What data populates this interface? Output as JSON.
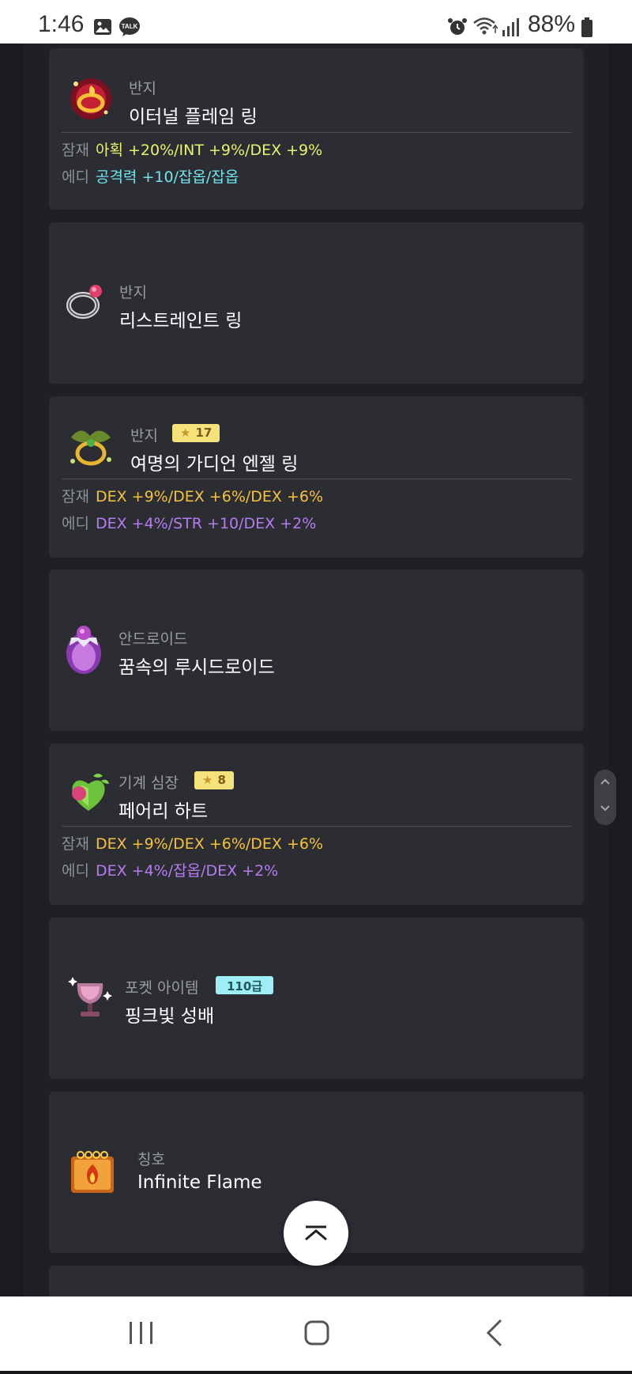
{
  "status_bar": {
    "time": "1:46",
    "notification_icons": [
      "gallery-icon",
      "kakaotalk-icon"
    ],
    "kakaotalk_label": "TALK",
    "system_icons": [
      "alarm-icon",
      "wifi-icon",
      "signal-icon"
    ],
    "battery_percent": "88%"
  },
  "items": [
    {
      "category": "반지",
      "name": "이터널 플레임 링",
      "icon": "flame-ring-icon",
      "potential_label": "잠재",
      "potential": "아획 +20%/INT +9%/DEX +9%",
      "additional_label": "에디",
      "additional": "공격력 +10/잡옵/잡옵"
    },
    {
      "category": "반지",
      "name": "리스트레인트 링",
      "icon": "restraint-ring-icon"
    },
    {
      "category": "반지",
      "star": "17",
      "name": "여명의 가디언 엔젤 링",
      "icon": "guardian-angel-ring-icon",
      "potential_label": "잠재",
      "potential": "DEX +9%/DEX +6%/DEX +6%",
      "additional_label": "에디",
      "additional": "DEX +4%/STR +10/DEX +2%"
    },
    {
      "category": "안드로이드",
      "name": "꿈속의 루시드로이드",
      "icon": "lucidroid-icon"
    },
    {
      "category": "기계 심장",
      "star": "8",
      "name": "페어리 하트",
      "icon": "fairy-heart-icon",
      "potential_label": "잠재",
      "potential": "DEX +9%/DEX +6%/DEX +6%",
      "additional_label": "에디",
      "additional": "DEX +4%/잡옵/DEX +2%"
    },
    {
      "category": "포켓 아이템",
      "grade": "110급",
      "name": "핑크빛 성배",
      "icon": "pink-chalice-icon"
    },
    {
      "category": "칭호",
      "name": "Infinite Flame",
      "icon": "title-book-icon"
    }
  ],
  "colors": {
    "background": "#1b1c20",
    "card": "#2b2d33",
    "potential_yellow": "#e9f26b",
    "additional_cyan": "#6fe4ea",
    "potential_orange": "#f5c23b",
    "additional_purple": "#b57cf0",
    "star_badge": "#f6e27a",
    "grade_badge": "#9deef5"
  },
  "controls": {
    "scroll_up_icon": "chevron-up-icon",
    "scroll_down_icon": "chevron-down-icon",
    "scroll_to_top_icon": "chevron-up-icon"
  },
  "nav_bar": {
    "buttons": [
      "recent-apps-icon",
      "home-icon",
      "back-icon"
    ]
  }
}
